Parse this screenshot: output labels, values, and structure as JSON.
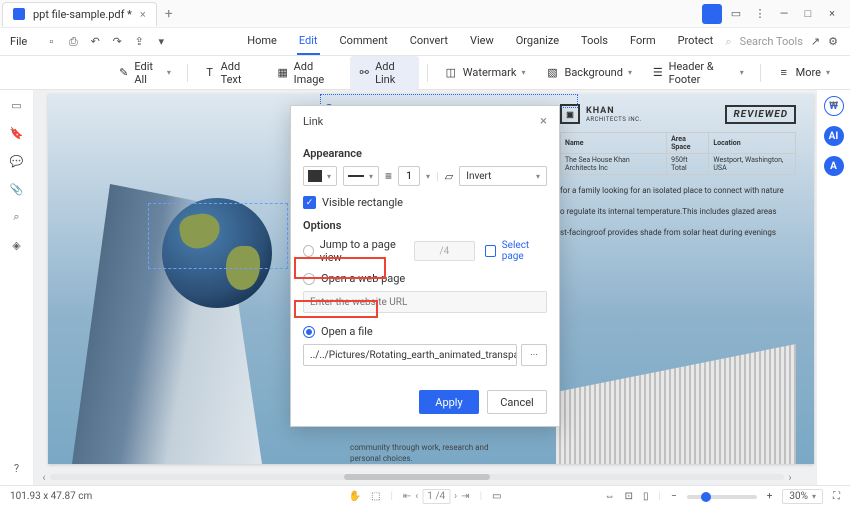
{
  "tab": {
    "title": "ppt file-sample.pdf *"
  },
  "menubar": {
    "file": "File"
  },
  "main_tabs": {
    "home": "Home",
    "edit": "Edit",
    "comment": "Comment",
    "convert": "Convert",
    "view": "View",
    "organize": "Organize",
    "tools": "Tools",
    "form": "Form",
    "protect": "Protect"
  },
  "search": {
    "placeholder": "Search Tools"
  },
  "ribbon": {
    "edit_all": "Edit All",
    "add_text": "Add Text",
    "add_image": "Add Image",
    "add_link": "Add Link",
    "watermark": "Watermark",
    "background": "Background",
    "header_footer": "Header & Footer",
    "more": "More"
  },
  "document": {
    "brand": "KHAN",
    "brand_sub": "ARCHITECTS INC.",
    "reviewed": "REVIEWED",
    "table_headers": {
      "name": "Name",
      "area": "Area Space",
      "location": "Location"
    },
    "table_data": {
      "name": "The Sea House Khan Architects Inc",
      "area": "950ft Total",
      "location": "Westport, Washington, USA"
    },
    "para1": "for a family looking for an isolated place to connect with nature",
    "para2": "o regulate its internal temperature.This includes glazed areas",
    "para3": "st-facingroof provides shade from solar heat during evenings",
    "para_below": "community through work, research and personal choices."
  },
  "dialog": {
    "title": "Link",
    "appearance": "Appearance",
    "thickness": "1",
    "invert": "Invert",
    "visible": "Visible rectangle",
    "options": "Options",
    "jump": "Jump to a page view",
    "page_total": "/4",
    "select_page": "Select page",
    "open_web": "Open a web page",
    "url_placeholder": "Enter the website URL",
    "open_file": "Open a file",
    "file_path": "../../Pictures/Rotating_earth_animated_transparent.gif",
    "browse": "···",
    "apply": "Apply",
    "cancel": "Cancel"
  },
  "status": {
    "coords": "101.93 x 47.87 cm",
    "page": "1",
    "page_total": "/4",
    "zoom": "30%"
  }
}
